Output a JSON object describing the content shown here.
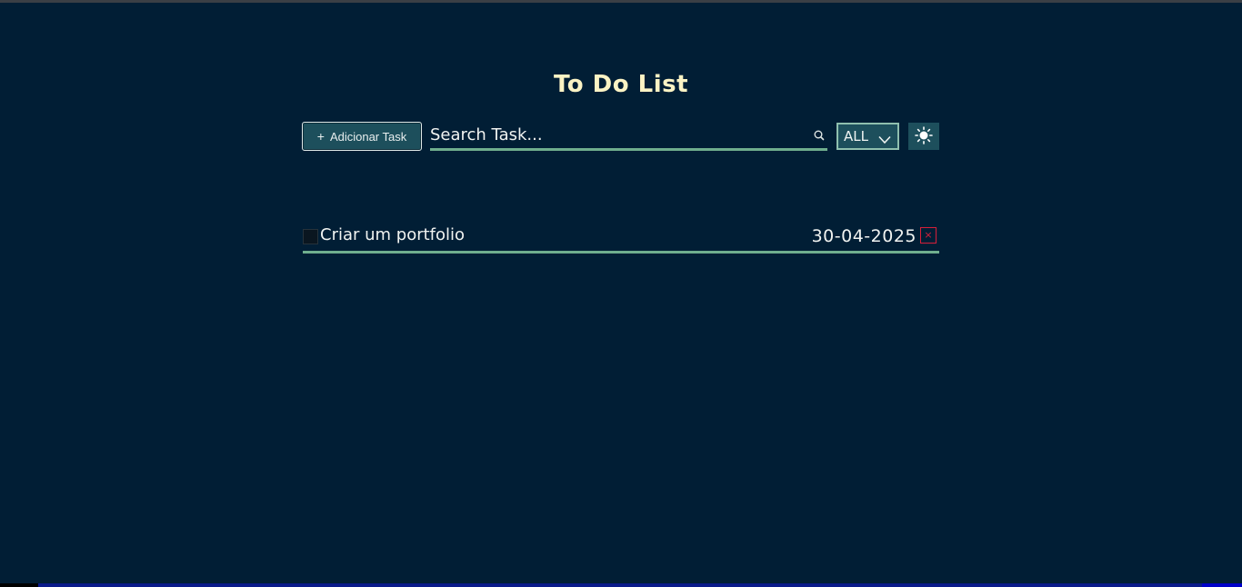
{
  "page": {
    "title": "To Do List"
  },
  "toolbar": {
    "add_button_icon": "+",
    "add_button_label": "Adicionar Task",
    "search_placeholder": "Search Task...",
    "search_value": "",
    "search_icon": "search-icon",
    "filter_selected": "ALL",
    "theme_icon": "sun-icon"
  },
  "tasks": [
    {
      "text": "Criar um portfolio",
      "date": "30-04-2025",
      "completed": false,
      "delete_label": "×"
    }
  ],
  "colors": {
    "background": "#011e35",
    "title": "#fbf3c4",
    "accent": "#1d4f5c",
    "underline": "#6fae8e",
    "delete": "#d81f3a"
  }
}
